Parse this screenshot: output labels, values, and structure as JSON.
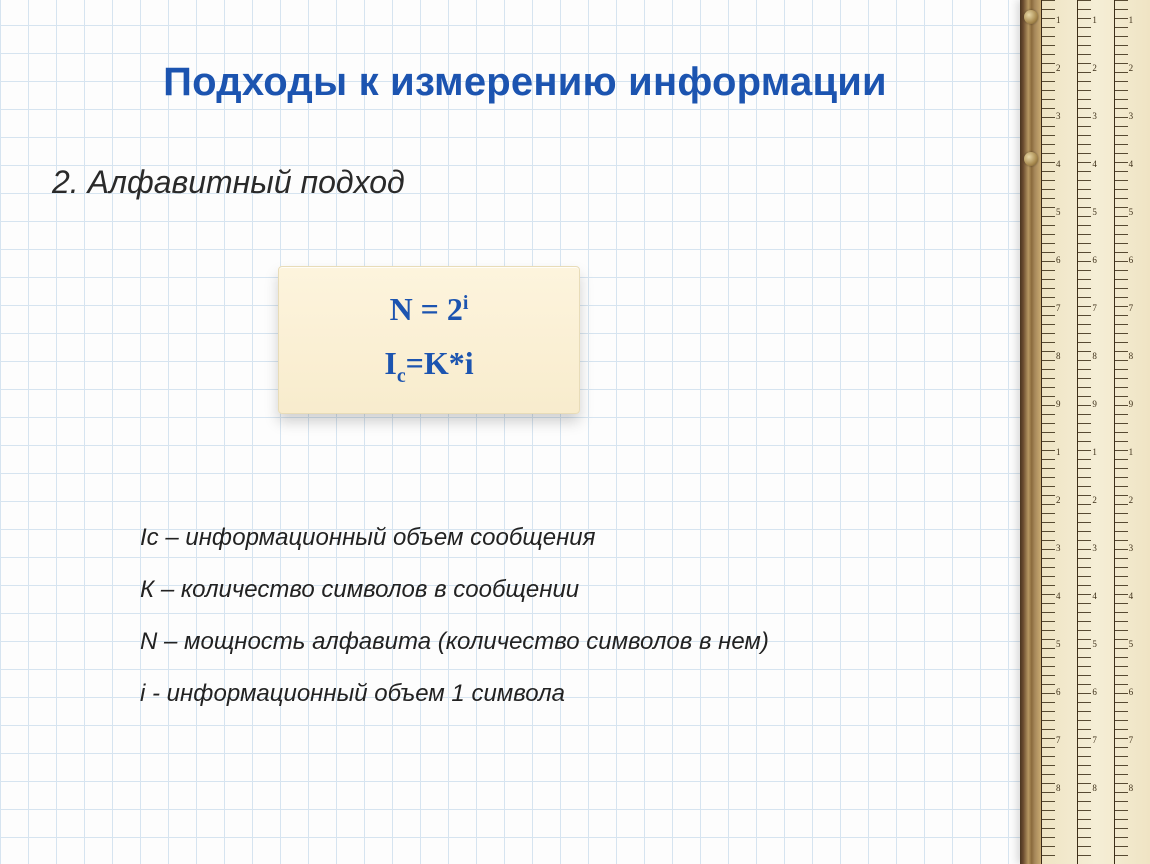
{
  "slide": {
    "title": "Подходы к измерению информации",
    "subtitle": "2. Алфавитный подход",
    "formula1_html": "N = 2<sup>i</sup>",
    "formula2_html": "I<sub>c</sub>=K*i",
    "defs": [
      "Iс – информационный объем сообщения",
      "К – количество символов в сообщении",
      "N – мощность алфавита (количество символов в нем)",
      "i  - информационный объем 1 символа"
    ]
  },
  "ruler": {
    "scale_numbers": [
      "1",
      "2",
      "3",
      "4",
      "5",
      "6",
      "7",
      "8",
      "9",
      "1",
      "2",
      "3",
      "4",
      "5",
      "6",
      "7",
      "8"
    ]
  },
  "colors": {
    "title_blue": "#1c54b0",
    "grid_line": "#d6e4f0",
    "formula_bg_top": "#fdf4dd",
    "formula_bg_bottom": "#f8eccd"
  }
}
